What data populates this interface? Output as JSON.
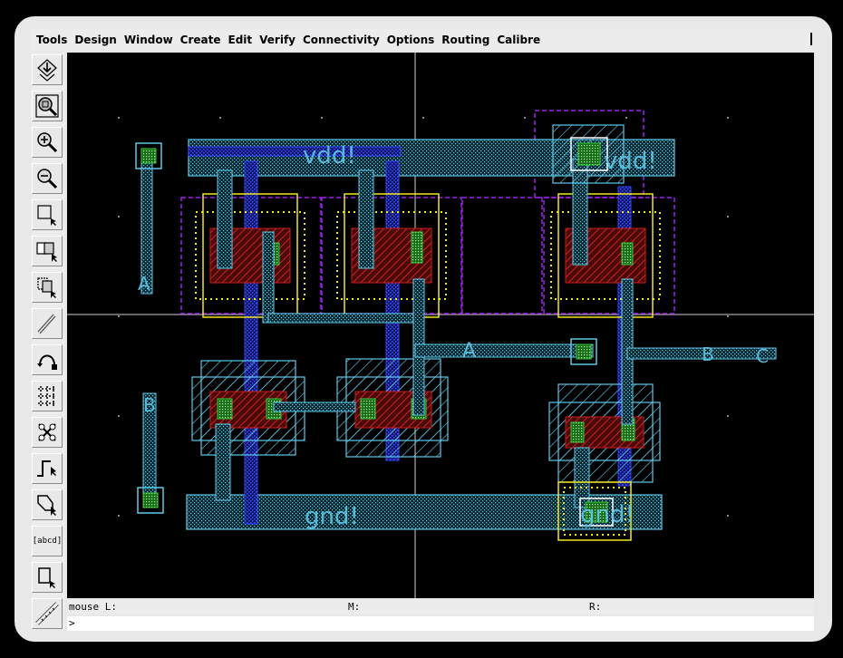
{
  "menu": {
    "items": [
      "Tools",
      "Design",
      "Window",
      "Create",
      "Edit",
      "Verify",
      "Connectivity",
      "Options",
      "Routing",
      "Calibre"
    ]
  },
  "toolbar": {
    "tools": [
      {
        "name": "save-tool",
        "icon": "save-icon"
      },
      {
        "name": "fit-tool",
        "icon": "zoom-fit-icon"
      },
      {
        "name": "zoom-in-tool",
        "icon": "zoom-in-icon"
      },
      {
        "name": "zoom-out-tool",
        "icon": "zoom-out-icon"
      },
      {
        "name": "stretch-tool",
        "icon": "stretch-icon"
      },
      {
        "name": "copy-tool",
        "icon": "copy-icon"
      },
      {
        "name": "move-tool",
        "icon": "move-icon"
      },
      {
        "name": "delete-tool",
        "icon": "delete-icon"
      },
      {
        "name": "undo-tool",
        "icon": "undo-icon"
      },
      {
        "name": "ruler-tool",
        "icon": "ruler-icon"
      },
      {
        "name": "properties-tool",
        "icon": "properties-icon"
      },
      {
        "name": "path-tool",
        "icon": "path-icon"
      },
      {
        "name": "polygon-tool",
        "icon": "polygon-icon"
      },
      {
        "name": "label-tool",
        "icon": "label-icon",
        "label": "[abcd]"
      },
      {
        "name": "rectangle-tool",
        "icon": "rectangle-icon"
      },
      {
        "name": "measure-tool",
        "icon": "measure-icon"
      }
    ]
  },
  "layout": {
    "labels": {
      "vdd_left": "vdd!",
      "vdd_right": "vdd!",
      "gnd_left": "gnd!",
      "gnd_right": "gnd!",
      "pin_a_left": "A",
      "pin_a_mid": "A",
      "pin_b_left": "B",
      "pin_b_right": "B",
      "pin_c_right": "C"
    },
    "colors": {
      "background": "#000000",
      "metal1": "#5ec8e8",
      "poly": "#2a3cff",
      "diffusion": "#c81e1e",
      "contact": "#37c837",
      "nwell": "#a020f0",
      "implant": "#f2e61e"
    }
  },
  "status": {
    "mouse_l": "mouse L:",
    "mouse_m": "M:",
    "mouse_r": "R:"
  },
  "command": {
    "prompt": ">"
  }
}
